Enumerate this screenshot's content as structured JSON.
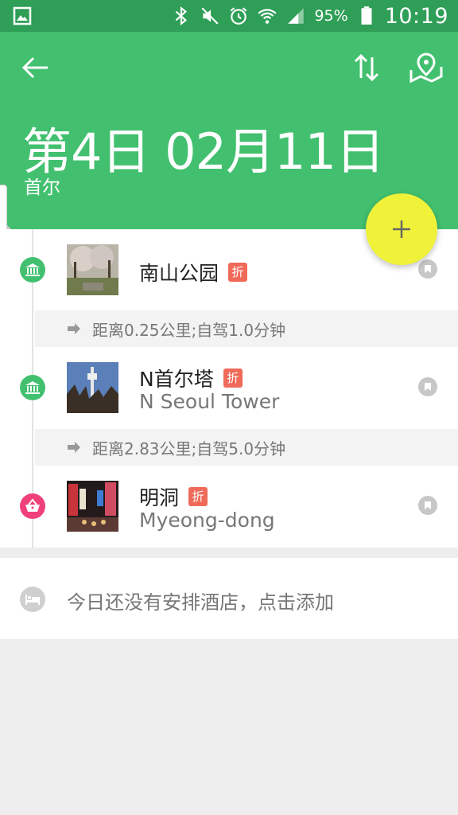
{
  "status_bar": {
    "battery_percent": "95%",
    "time": "10:19",
    "icons": [
      "gallery-icon",
      "bluetooth-icon",
      "mute-icon",
      "alarm-icon",
      "wifi-icon",
      "signal-icon",
      "battery-icon"
    ]
  },
  "header": {
    "title": "第4日 02月11日",
    "subtitle": "首尔",
    "icons": [
      "back-arrow-icon",
      "sort-icon",
      "map-pin-icon"
    ]
  },
  "fab": {
    "icon": "plus-icon",
    "color": "#f0f23a"
  },
  "colors": {
    "header": "#42c06f",
    "status_bar": "#2f9e57",
    "attraction": "#42c06f",
    "shopping": "#f0407a",
    "discount_badge": "#f06a5a"
  },
  "itinerary": {
    "items": [
      {
        "name": "南山公园",
        "name_en": "",
        "badge": "折",
        "type_icon": "museum-icon"
      },
      {
        "name": "N首尔塔",
        "name_en": "N Seoul Tower",
        "badge": "折",
        "type_icon": "museum-icon"
      },
      {
        "name": "明洞",
        "name_en": "Myeong-dong",
        "badge": "折",
        "type_icon": "shopping-basket-icon"
      }
    ],
    "routes": [
      {
        "text": "距离0.25公里;自驾1.0分钟"
      },
      {
        "text": "距离2.83公里;自驾5.0分钟"
      }
    ]
  },
  "hotel": {
    "text": "今日还没有安排酒店，点击添加",
    "icon": "bed-icon"
  }
}
